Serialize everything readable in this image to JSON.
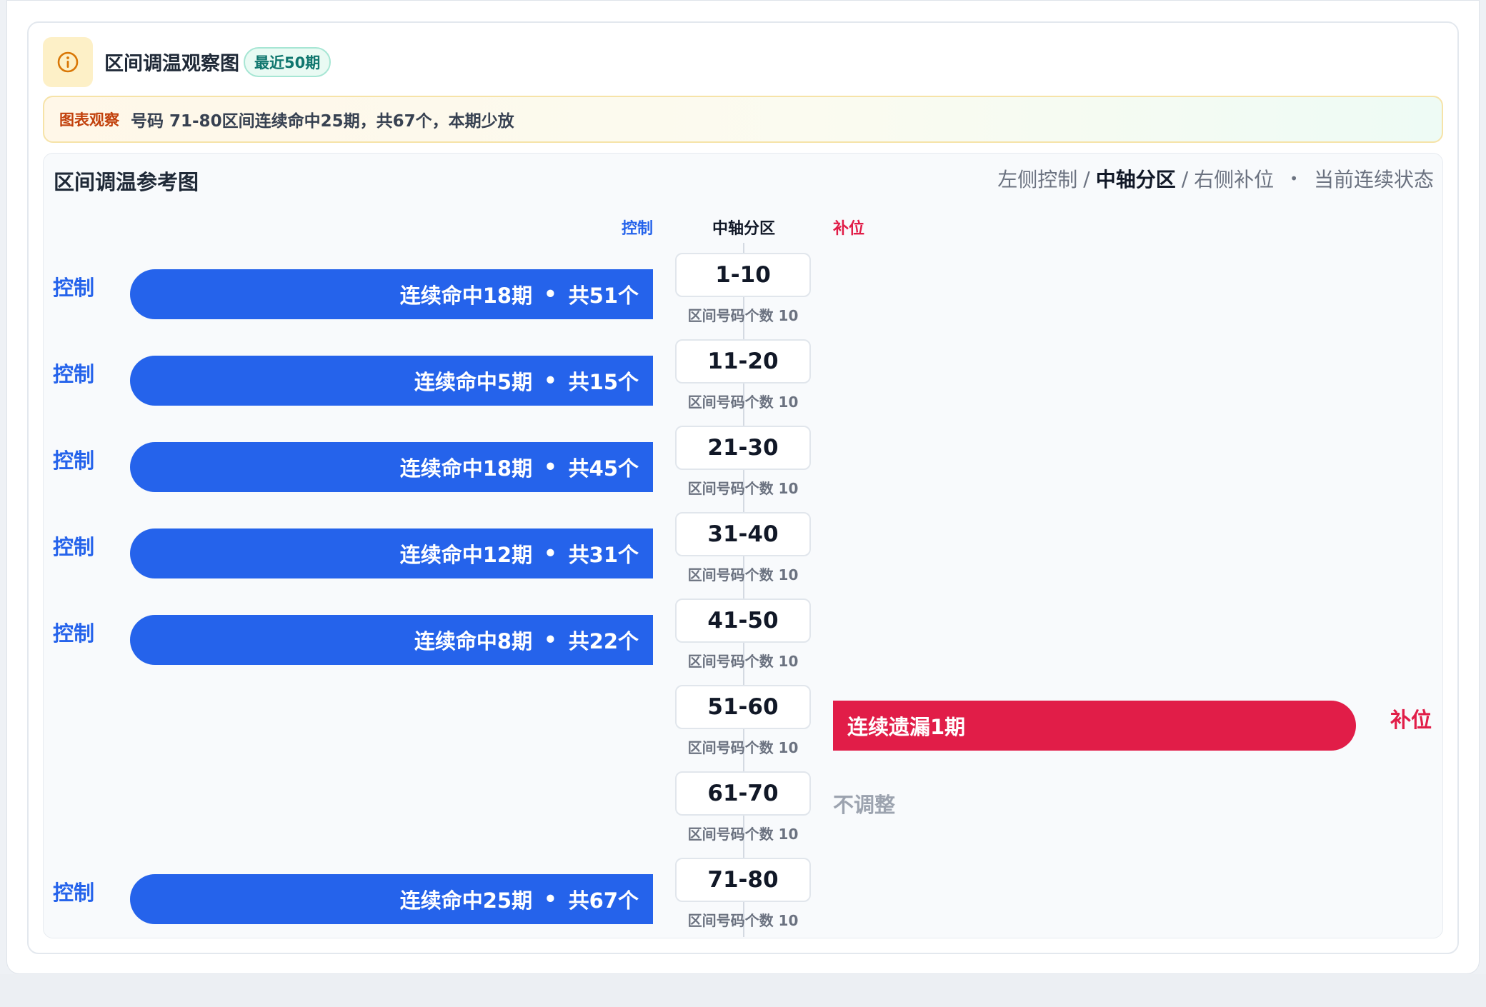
{
  "header": {
    "title": "区间调温观察图",
    "period_tag": "最近50期",
    "icon": "info-icon"
  },
  "notice": {
    "label": "图表观察",
    "text": "号码 71-80区间连续命中25期，共67个，本期少放"
  },
  "panel": {
    "title": "区间调温参考图",
    "legend": {
      "left": "左侧控制",
      "sep1": "/",
      "center": "中轴分区",
      "sep2": "/",
      "right": "右侧补位",
      "dot": "•",
      "state": "当前连续状态"
    },
    "columns": {
      "control": "控制",
      "axis": "中轴分区",
      "fill": "补位"
    }
  },
  "colors": {
    "control": "#2563eb",
    "fill": "#e11d48",
    "neutral": "#9ca3af"
  },
  "rows": [
    {
      "zone": "1-10",
      "sub": "区间号码个数 10",
      "side": "控制",
      "streak": "连续命中18期",
      "dot": "•",
      "total": "共51个"
    },
    {
      "zone": "11-20",
      "sub": "区间号码个数 10",
      "side": "控制",
      "streak": "连续命中5期",
      "dot": "•",
      "total": "共15个"
    },
    {
      "zone": "21-30",
      "sub": "区间号码个数 10",
      "side": "控制",
      "streak": "连续命中18期",
      "dot": "•",
      "total": "共45个"
    },
    {
      "zone": "31-40",
      "sub": "区间号码个数 10",
      "side": "控制",
      "streak": "连续命中12期",
      "dot": "•",
      "total": "共31个"
    },
    {
      "zone": "41-50",
      "sub": "区间号码个数 10",
      "side": "控制",
      "streak": "连续命中8期",
      "dot": "•",
      "total": "共22个"
    },
    {
      "zone": "51-60",
      "sub": "区间号码个数 10",
      "fill_text": "连续遗漏1期",
      "fill_side": "补位"
    },
    {
      "zone": "61-70",
      "sub": "区间号码个数 10",
      "neutral": "不调整"
    },
    {
      "zone": "71-80",
      "sub": "区间号码个数 10",
      "side": "控制",
      "streak": "连续命中25期",
      "dot": "•",
      "total": "共67个"
    }
  ]
}
